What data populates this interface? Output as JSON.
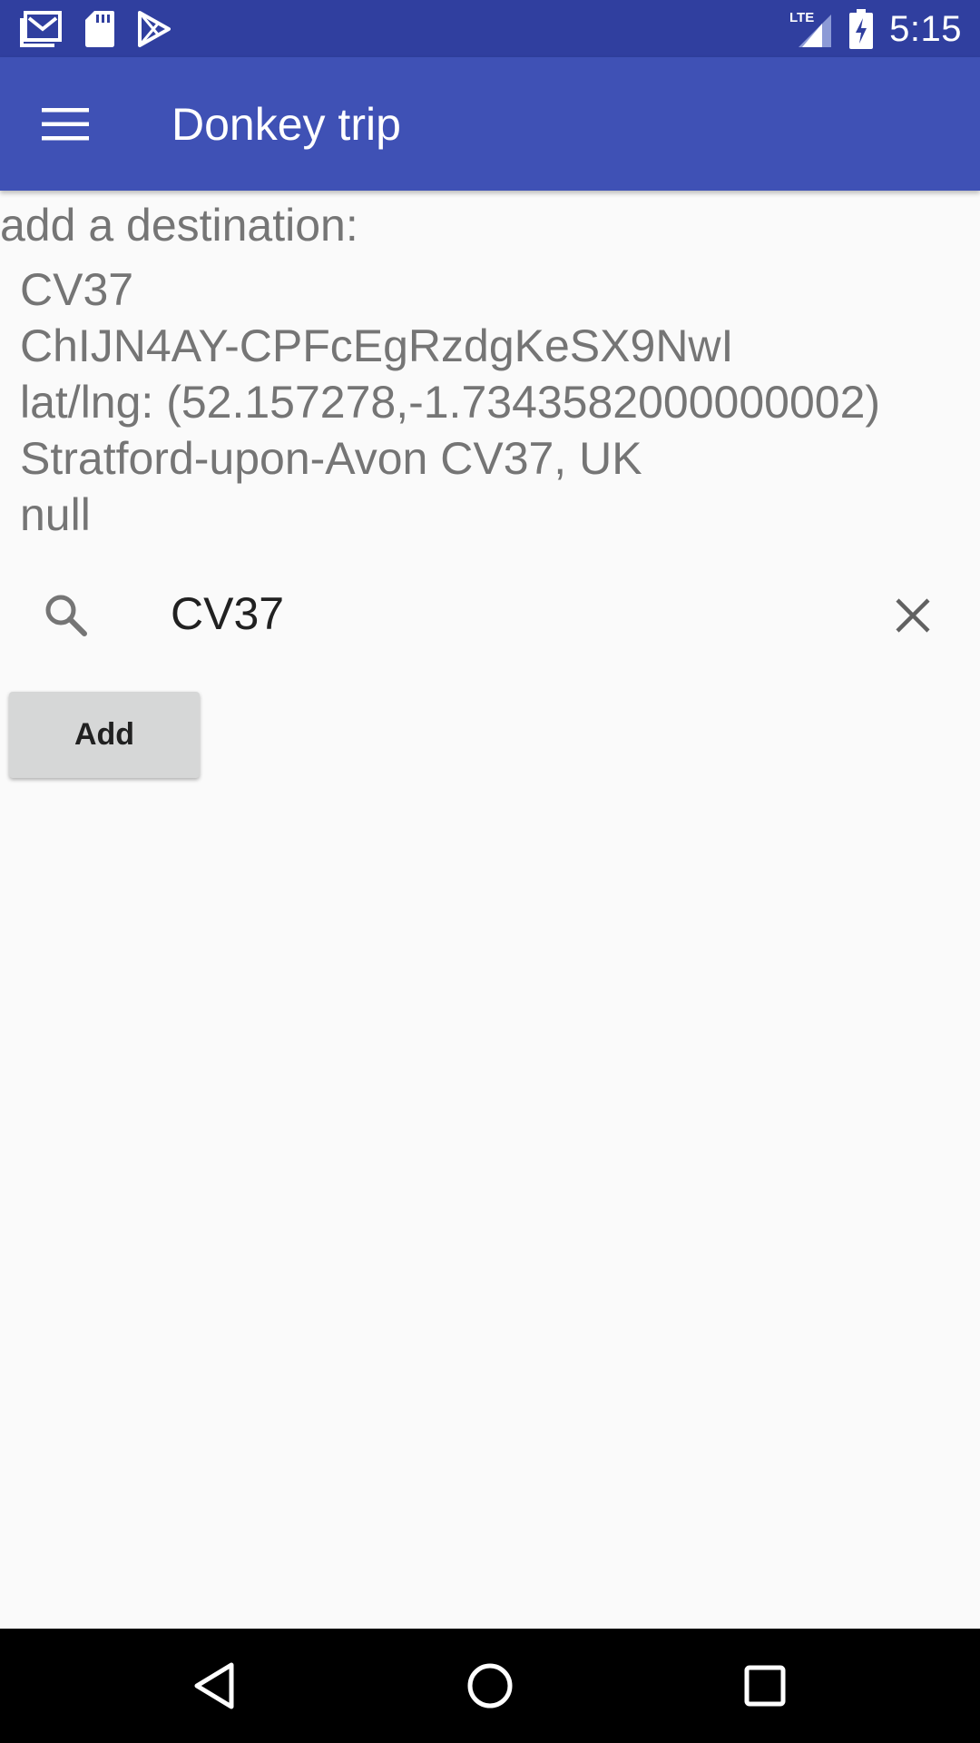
{
  "status_bar": {
    "time": "5:15",
    "network_label": "LTE",
    "left_icons": [
      "gmail-icon",
      "sd-card-icon",
      "play-store-icon"
    ],
    "right_icons": [
      "signal-icon",
      "battery-charging-icon"
    ]
  },
  "toolbar": {
    "title": "Donkey trip",
    "menu_icon": "hamburger-menu-icon",
    "color": "#3f51b5",
    "status_color": "#303f9f"
  },
  "main": {
    "heading": "add a destination:",
    "place": {
      "name": "CV37",
      "place_id": "ChIJN4AY-CPFcEgRzdgKeSX9NwI",
      "latlng": "lat/lng: (52.157278,-1.7343582000000002)",
      "address": "Stratford-upon-Avon CV37, UK",
      "extra": "null"
    },
    "search": {
      "value": "CV37",
      "search_icon": "search-icon",
      "clear_icon": "close-icon"
    },
    "add_button_label": "Add"
  },
  "nav_bar": {
    "buttons": [
      "back-icon",
      "home-icon",
      "recents-icon"
    ]
  }
}
